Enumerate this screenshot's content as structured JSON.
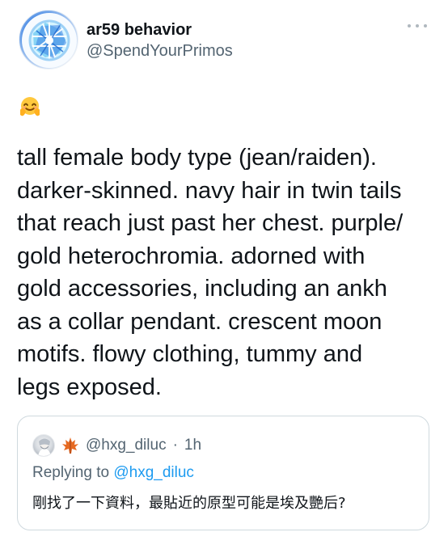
{
  "tweet": {
    "author": {
      "display_name": "ar59 behavior",
      "handle": "@SpendYourPrimos",
      "avatar_icon": "globe-network-avatar"
    },
    "more_icon": "more-horizontal-icon",
    "emoji": "smiling-face-with-open-hands-emoji",
    "text": "tall female body type (jean/raiden).\ndarker-skinned. navy hair in twin tails\nthat reach just past her chest. purple/\ngold heterochromia. adorned with\ngold accessories, including an ankh\nas a collar pendant. crescent moon\nmotifs. flowy clothing, tummy and\nlegs exposed.",
    "quoted": {
      "avatar_icon": "person-avatar",
      "badge_icon": "maple-leaf-icon",
      "handle": "@hxg_diluc",
      "separator": "·",
      "time": "1h",
      "replying_prefix": "Replying to",
      "replying_to": "@hxg_diluc",
      "text": "剛找了一下資料，最貼近的原型可能是埃及艷后?"
    }
  },
  "colors": {
    "primary_text": "#0f1419",
    "secondary_text": "#536471",
    "link": "#1d9bf0",
    "border": "#cfd9de"
  }
}
